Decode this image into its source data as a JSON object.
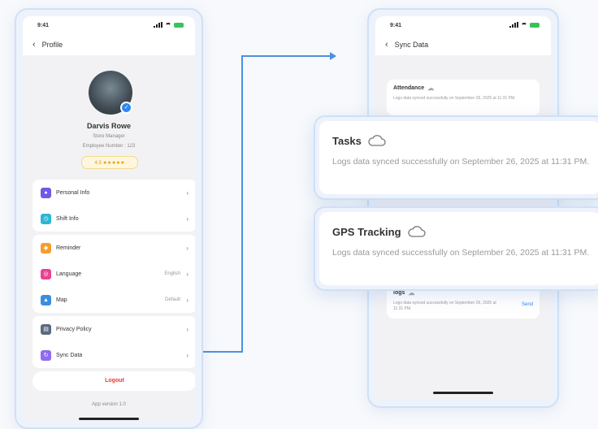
{
  "colors": {
    "accent": "#2f86f5",
    "logout": "#e53935",
    "connector": "#4a90e2",
    "frame": "#cfe0f7"
  },
  "profile_screen": {
    "time": "9:41",
    "nav_title": "Profile",
    "user_name": "Darvis Rowe",
    "user_role": "Store Manager",
    "user_meta": "Employee Number : 123",
    "rating": "4.5 ★★★★★",
    "menu_groups": [
      [
        {
          "label": "Personal Info",
          "icon": "user-icon",
          "color": "#6c5ce7",
          "value": ""
        },
        {
          "label": "Shift Info",
          "icon": "clock-icon",
          "color": "#2bb6d6",
          "value": ""
        }
      ],
      [
        {
          "label": "Reminder",
          "icon": "bell-icon",
          "color": "#f59e2b",
          "value": ""
        },
        {
          "label": "Language",
          "icon": "globe-icon",
          "color": "#e84393",
          "value": "English"
        },
        {
          "label": "Map",
          "icon": "map-icon",
          "color": "#3b8de0",
          "value": "Default"
        }
      ],
      [
        {
          "label": "Privacy Policy",
          "icon": "document-icon",
          "color": "#5b6b80",
          "value": ""
        },
        {
          "label": "Sync Data",
          "icon": "sync-icon",
          "color": "#8e6bf0",
          "value": ""
        }
      ]
    ],
    "logout_label": "Logout",
    "version": "App version 1.0"
  },
  "sync_screen": {
    "time": "9:41",
    "nav_title": "Sync Data",
    "attendance": {
      "title": "Attendance",
      "desc": "Logs data synced successfully on September 26, 2025 at 11:31 PM."
    },
    "logs": {
      "title": "logs",
      "desc": "Logs data synced successfully on September 26, 2025 at 11:31 PM.",
      "action": "Send"
    }
  },
  "cards": [
    {
      "title": "Tasks",
      "icon": "cloud-icon",
      "desc": "Logs data synced successfully on September 26, 2025 at 11:31 PM."
    },
    {
      "title": "GPS Tracking",
      "icon": "cloud-icon",
      "desc": "Logs data synced successfully on September 26, 2025 at 11:31 PM."
    }
  ]
}
